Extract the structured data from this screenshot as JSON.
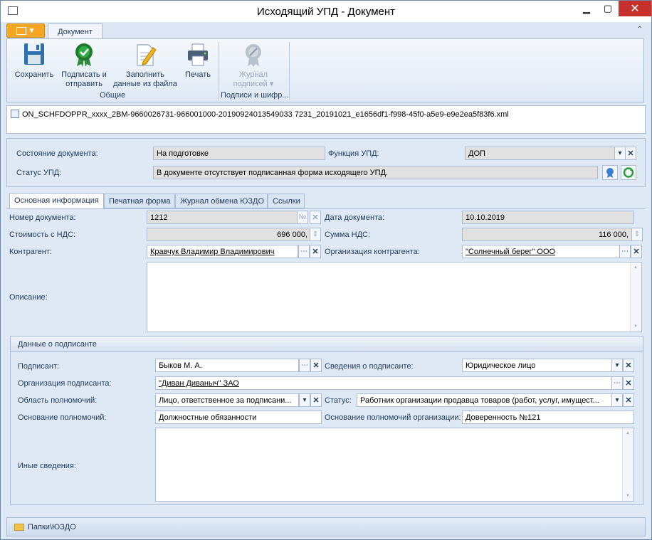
{
  "window": {
    "title": "Исходящий УПД - Документ",
    "minimize": "▁",
    "maximize": "▢",
    "close": "✕"
  },
  "ribbon": {
    "app_menu_glyph": "▼",
    "tab_document": "Документ",
    "collapse_glyph": "⌃",
    "buttons": {
      "save": "Сохранить",
      "sign_send_1": "Подписать и",
      "sign_send_2": "отправить",
      "fill_1": "Заполнить",
      "fill_2": "данные из файла",
      "print": "Печать",
      "journal_1": "Журнал",
      "journal_2": "подписей ▾"
    },
    "groups": {
      "common": "Общие",
      "signatures": "Подписи и шифр..."
    },
    "icons": {
      "save": "floppy-icon",
      "sign": "certificate-icon",
      "fill": "document-edit-icon",
      "print": "printer-icon",
      "journal": "seal-icon"
    }
  },
  "file": {
    "name": "ON_SCHFDOPPR_xxxx_2BM-9660026731-966001000-20190924013549033 7231_20191021_e1656df1-f998-45f0-a5e9-e9e2ea5f83f6.xml"
  },
  "status": {
    "state_label": "Состояние документа:",
    "state_value": "На подготовке",
    "function_label": "Функция УПД:",
    "function_value": "ДОП",
    "upd_status_label": "Статус УПД:",
    "upd_status_value": "В документе отсутствует подписанная форма исходящего УПД."
  },
  "tabs": [
    "Основная информация",
    "Печатная форма",
    "Журнал обмена ЮЗДО",
    "Ссылки"
  ],
  "main": {
    "doc_number_label": "Номер документа:",
    "doc_number_value": "1212",
    "doc_number_btn": "№",
    "doc_date_label": "Дата документа:",
    "doc_date_value": "10.10.2019",
    "cost_label": "Стоимость с НДС:",
    "cost_value": "696 000,",
    "vat_label": "Сумма НДС:",
    "vat_value": "116 000,",
    "counterparty_label": "Контрагент:",
    "counterparty_value": "Кравчук Владимир Владимирович",
    "cp_org_label": "Организация контрагента:",
    "cp_org_value": "\"Солнечный берег\" ООО",
    "description_label": "Описание:",
    "description_value": ""
  },
  "signer": {
    "header": "Данные о подписанте",
    "signer_label": "Подписант:",
    "signer_value": "Быков М. А.",
    "signer_info_label": "Сведения о подписанте:",
    "signer_info_value": "Юридическое лицо",
    "signer_org_label": "Организация подписанта:",
    "signer_org_value": "\"Диван Диваныч\" ЗАО",
    "authority_label": "Область полномочий:",
    "authority_value": "Лицо, ответственное за подписани...",
    "status_label": "Статус:",
    "status_value": "Работник организации продавца товаров (работ, услуг, имущест...",
    "basis_label": "Основание полномочий:",
    "basis_value": "Должностные обязанности",
    "org_basis_label": "Основание полномочий организации:",
    "org_basis_value": "Доверенность №121",
    "other_label": "Иные сведения:",
    "other_value": ""
  },
  "controls": {
    "ellipsis": "⋯",
    "clear": "✕",
    "dropdown": "▾",
    "spin": "⇕"
  },
  "statusbar": {
    "path": "Папки\\ЮЗДО"
  }
}
